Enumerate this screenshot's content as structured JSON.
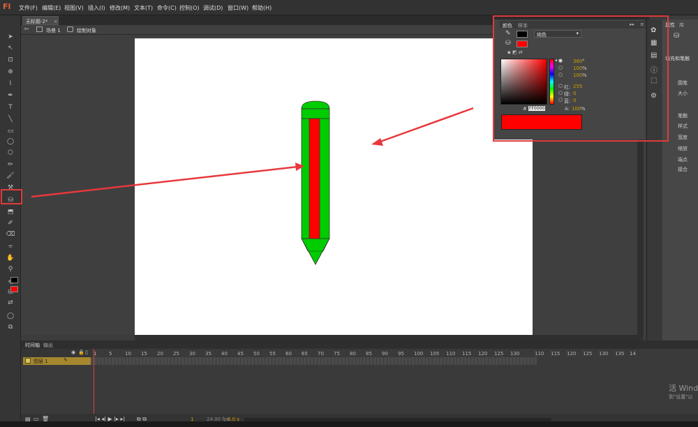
{
  "app": {
    "logo": "Fl"
  },
  "menu": [
    "文件(F)",
    "编辑(E)",
    "视图(V)",
    "插入(I)",
    "修改(M)",
    "文本(T)",
    "命令(C)",
    "控制(O)",
    "调试(D)",
    "窗口(W)",
    "帮助(H)"
  ],
  "document_tab": {
    "title": "无标题-2*",
    "close": "×"
  },
  "scene_bar": {
    "scene": "场景 1",
    "object": "绘制对象"
  },
  "color_panel": {
    "tabs": [
      "颜色",
      "样本"
    ],
    "fill_type": "纯色",
    "stroke_color": "#000000",
    "fill_color": "#ff0000",
    "hsb": {
      "H": "360",
      "H_unit": "°",
      "S": "100",
      "S_unit": "%",
      "B": "100",
      "B_unit": "%"
    },
    "rgb": {
      "r_label": "红:",
      "r": "255",
      "g_label": "绿:",
      "g": "0",
      "b_label": "蓝:",
      "b": "0"
    },
    "hex_label": "#",
    "hex": "FF0000",
    "alpha_label": "A:",
    "alpha": "100",
    "alpha_unit": "%",
    "preview_color": "#ff0000"
  },
  "properties_panel": {
    "tabs": [
      "属性",
      "库"
    ],
    "section": "填充和笔触",
    "rows": [
      "笔触",
      "样式",
      "宽度",
      "缩放",
      "端点",
      "接合"
    ],
    "misc": [
      "圆笔",
      "大小"
    ]
  },
  "timeline": {
    "tabs": [
      "时间轴",
      "输出"
    ],
    "layer": "图层 1",
    "frame_numbers": [
      "1",
      "5",
      "10",
      "15",
      "20",
      "25",
      "30",
      "35",
      "40",
      "45",
      "50",
      "55",
      "60",
      "65",
      "70",
      "75",
      "80",
      "85",
      "90",
      "95",
      "100",
      "105",
      "110",
      "115",
      "120",
      "125",
      "130"
    ],
    "frame_numbers_right": [
      "110",
      "115",
      "120",
      "125",
      "130",
      "135",
      "14"
    ],
    "current_frame": "1",
    "fps": "24.00 fps",
    "time": "0.0 s"
  },
  "watermark": {
    "line1": "活 Wind",
    "line2": "到\"设置\"以"
  },
  "pencil": {
    "body_color": "#00cc00",
    "core_color": "#ff0000",
    "outline_color": "#333333"
  }
}
